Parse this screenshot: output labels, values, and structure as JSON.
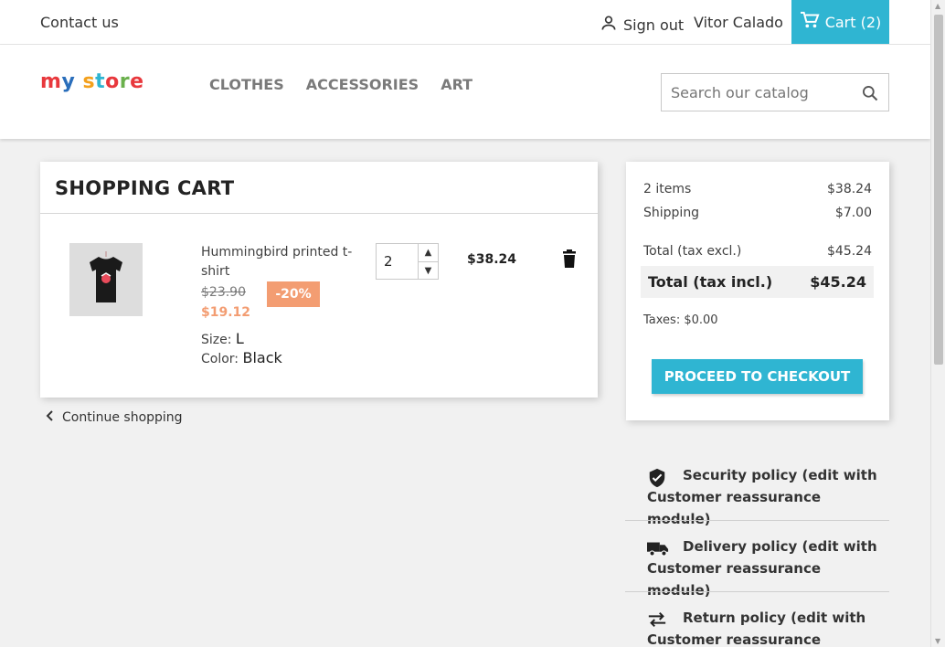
{
  "topbar": {
    "contact": "Contact us",
    "signout": "Sign out",
    "username": "Vitor Calado",
    "cart": "Cart (2)"
  },
  "header": {
    "logo": "my store",
    "nav": [
      "CLOTHES",
      "ACCESSORIES",
      "ART"
    ],
    "search_placeholder": "Search our catalog"
  },
  "cart": {
    "title": "SHOPPING CART",
    "item": {
      "name": "Hummingbird printed t-shirt",
      "regular_price": "$23.90",
      "discount": "-20%",
      "price": "$19.12",
      "size_label": "Size:",
      "size_value": "L",
      "color_label": "Color:",
      "color_value": "Black",
      "quantity": "2",
      "line_total": "$38.24"
    },
    "continue": "Continue shopping"
  },
  "summary": {
    "items_label": "2 items",
    "items_value": "$38.24",
    "shipping_label": "Shipping",
    "shipping_value": "$7.00",
    "total_excl_label": "Total (tax excl.)",
    "total_excl_value": "$45.24",
    "total_incl_label": "Total (tax incl.)",
    "total_incl_value": "$45.24",
    "taxes": "Taxes: $0.00",
    "checkout": "PROCEED TO CHECKOUT"
  },
  "reassurance": [
    {
      "icon": "shield-check-icon",
      "text": "Security policy (edit with Customer reassurance module)"
    },
    {
      "icon": "truck-icon",
      "text": "Delivery policy (edit with Customer reassurance module)"
    },
    {
      "icon": "swap-arrows-icon",
      "text": "Return policy (edit with Customer reassurance module)"
    }
  ],
  "colors": {
    "accent": "#2fb5d2",
    "discount": "#f39d72"
  }
}
